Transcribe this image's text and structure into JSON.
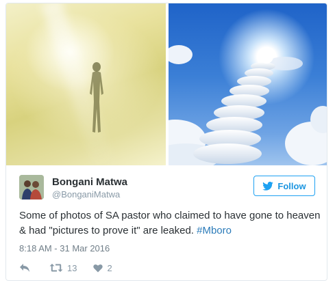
{
  "tweet": {
    "author_name": "Bongani Matwa",
    "author_handle": "@BonganiMatwa",
    "follow_label": "Follow",
    "text_before_hashtag": "Some of photos of SA pastor who claimed to have gone to heaven & had \"pictures to prove it\" are leaked. ",
    "hashtag": "#Mboro",
    "timestamp": "8:18 AM - 31 Mar 2016",
    "retweet_count": "13",
    "like_count": "2"
  },
  "icons": {
    "reply": "reply-icon",
    "retweet": "retweet-icon",
    "like": "heart-icon",
    "follow": "twitter-bird-icon"
  },
  "colors": {
    "accent": "#1da1f2",
    "hashtag": "#2b7bb9",
    "muted": "#8899a6",
    "text": "#292f33"
  }
}
